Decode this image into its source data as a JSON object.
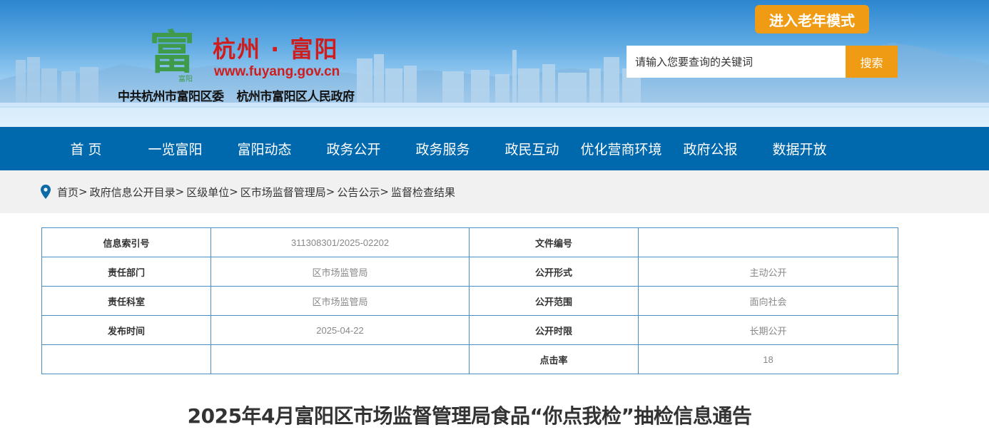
{
  "header": {
    "site_name": "杭州 · 富阳",
    "site_url": "www.fuyang.gov.cn",
    "org_party": "中共杭州市富阳区委",
    "org_gov": "杭州市富阳区人民政府",
    "logo_glyph": "富",
    "logo_caption": "富阳",
    "elder_mode_label": "进入老年模式",
    "search_placeholder": "请输入您要查询的关键词",
    "search_button": "搜索"
  },
  "nav": {
    "items": [
      {
        "label": "首 页"
      },
      {
        "label": "一览富阳"
      },
      {
        "label": "富阳动态"
      },
      {
        "label": "政务公开"
      },
      {
        "label": "政务服务"
      },
      {
        "label": "政民互动"
      },
      {
        "label": "优化营商环境"
      },
      {
        "label": "政府公报"
      },
      {
        "label": "数据开放"
      }
    ]
  },
  "breadcrumb": {
    "icon": "location-pin-icon",
    "items": [
      "首页",
      "政府信息公开目录",
      "区级单位",
      "区市场监督管理局",
      "公告公示",
      "监督检查结果"
    ]
  },
  "info": {
    "rows": [
      {
        "k1": "信息索引号",
        "v1": "311308301/2025-02202",
        "k2": "文件编号",
        "v2": ""
      },
      {
        "k1": "责任部门",
        "v1": "区市场监管局",
        "k2": "公开形式",
        "v2": "主动公开"
      },
      {
        "k1": "责任科室",
        "v1": "区市场监管局",
        "k2": "公开范围",
        "v2": "面向社会"
      },
      {
        "k1": "发布时间",
        "v1": "2025-04-22",
        "k2": "公开时限",
        "v2": "长期公开"
      },
      {
        "k1": "",
        "v1": "",
        "k2": "点击率",
        "v2": "18"
      }
    ]
  },
  "article": {
    "title": "2025年4月富阳区市场监督管理局食品“你点我检”抽检信息通告"
  },
  "colors": {
    "nav_bg": "#0068ad",
    "accent_orange": "#ef9c14",
    "brand_red": "#cf1d1d",
    "table_border": "#4a8fc4"
  }
}
